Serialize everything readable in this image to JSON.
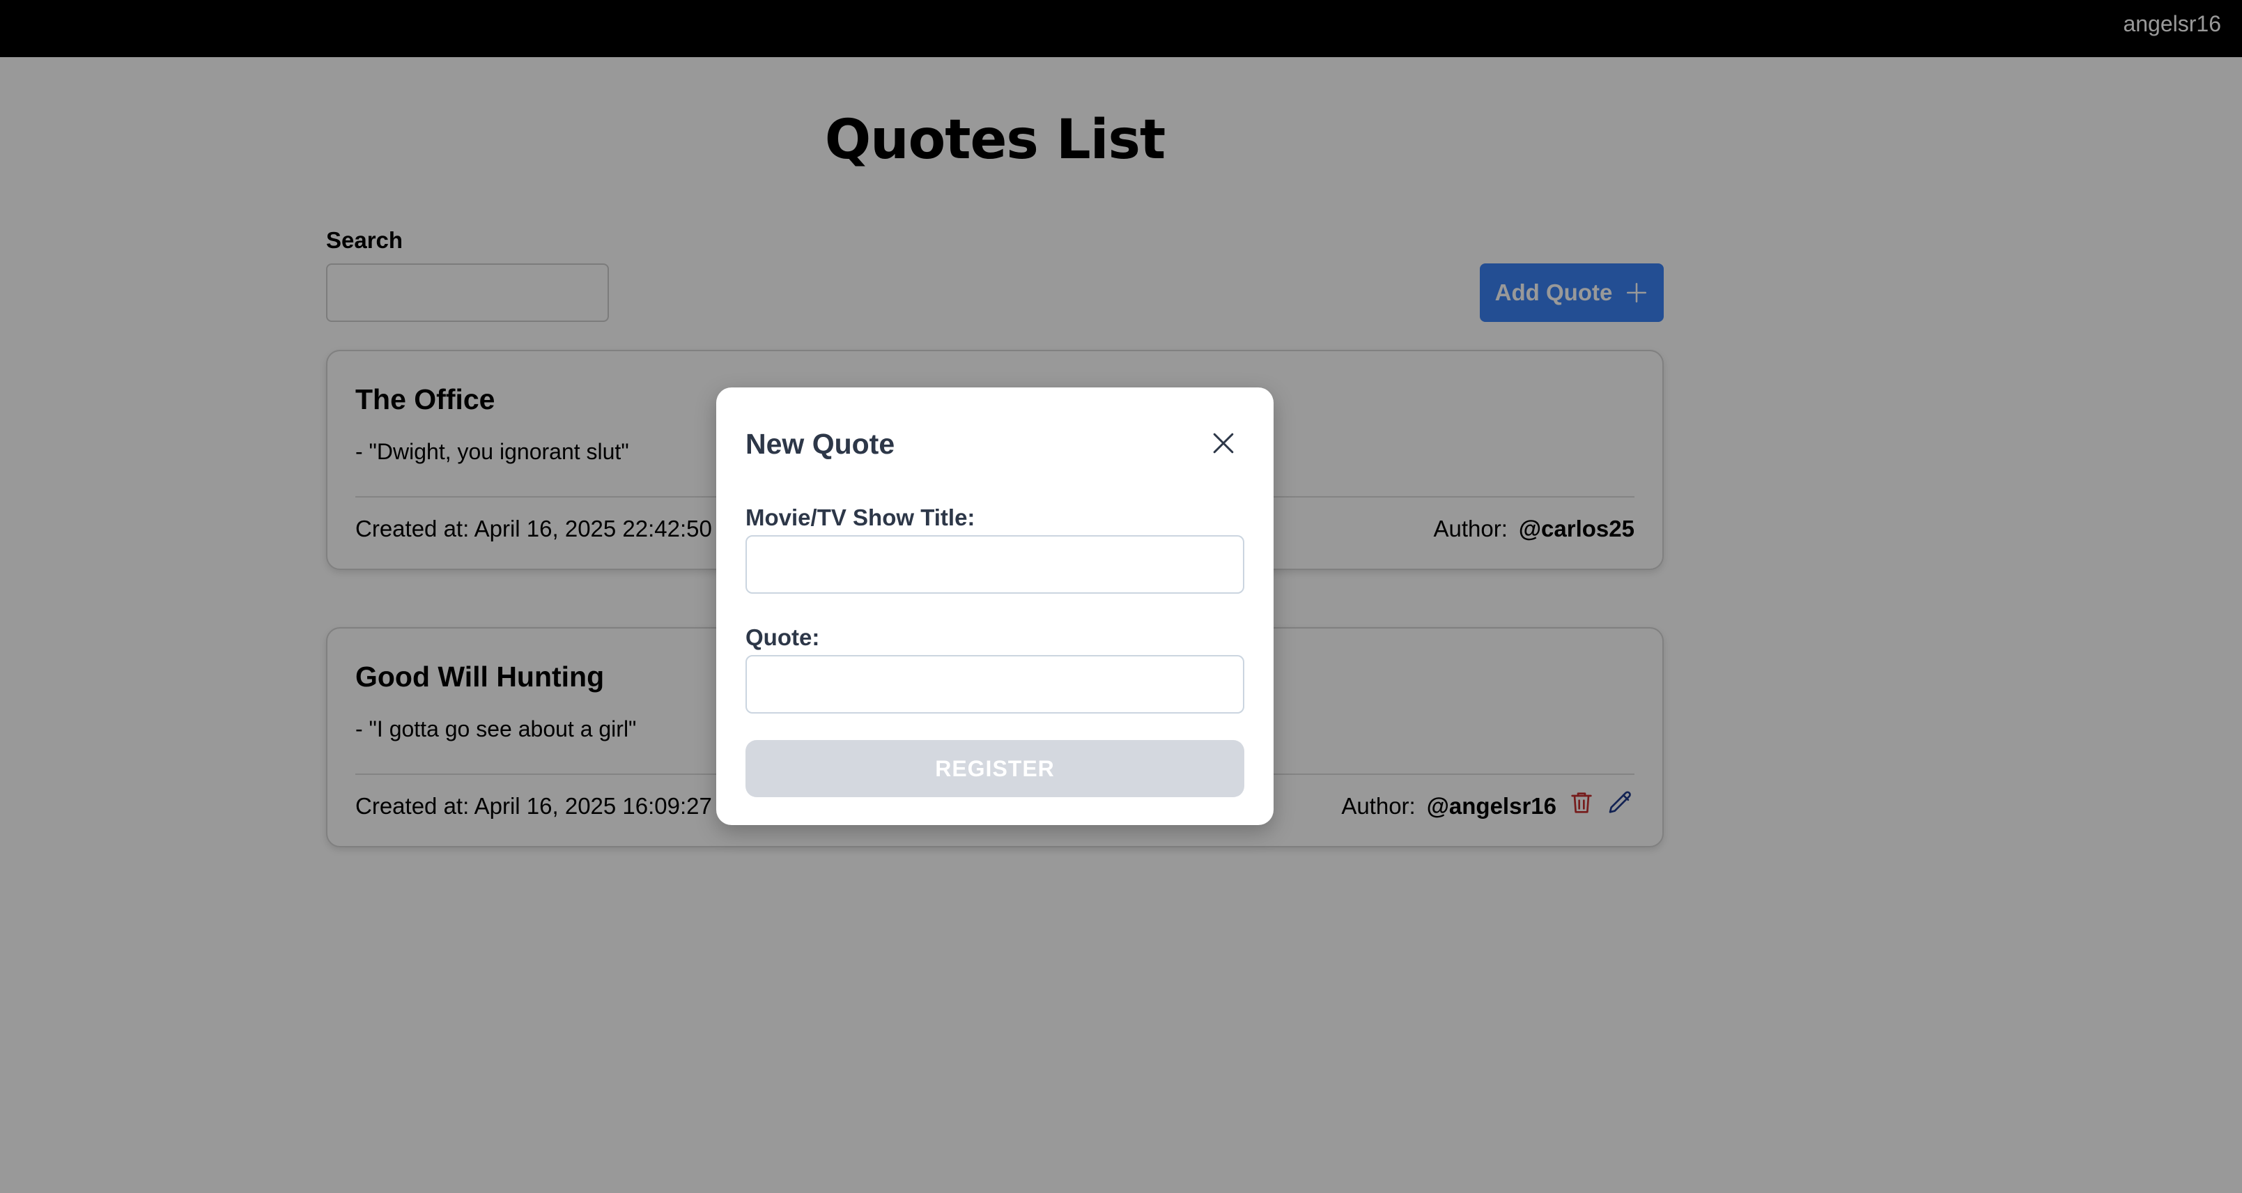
{
  "header": {
    "username": "angelsr16"
  },
  "page": {
    "title": "Quotes List"
  },
  "search": {
    "label": "Search",
    "value": ""
  },
  "toolbar": {
    "add_label": "Add Quote"
  },
  "quotes": [
    {
      "title": "The Office",
      "quote": "- \"Dwight, you ignorant slut\"",
      "created": "Created at: April 16, 2025 22:42:50",
      "author_label": "Author:",
      "author_handle": "@carlos25"
    },
    {
      "title": "Good Will Hunting",
      "quote": "- \"I gotta go see about a girl\"",
      "created": "Created at: April 16, 2025 16:09:27",
      "author_label": "Author:",
      "author_handle": "@angelsr16"
    }
  ],
  "modal": {
    "title": "New Quote",
    "title_field_label": "Movie/TV Show Title:",
    "title_field_value": "",
    "quote_field_label": "Quote:",
    "quote_field_value": "",
    "submit_label": "REGISTER"
  },
  "colors": {
    "accent": "#3b82f6",
    "delete": "#c53030",
    "edit": "#1e3a8a",
    "overlay": "rgba(0,0,0,0.4)"
  },
  "icons": {
    "add": "plus-icon",
    "close": "close-icon",
    "delete": "trash-icon",
    "edit": "pencil-icon"
  }
}
